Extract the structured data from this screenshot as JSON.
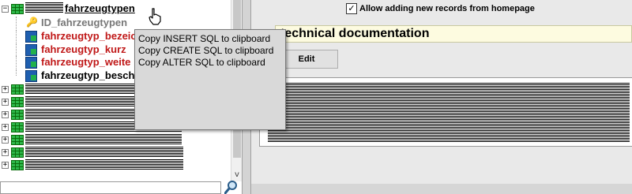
{
  "tree": {
    "top_label": "fahrzeugtypen",
    "fields": [
      {
        "label": "ID_fahrzeugtypen",
        "style": "gray",
        "icon": "key-icon"
      },
      {
        "label": "fahrzeugtyp_bezeichnung",
        "style": "red",
        "icon": "field-icon"
      },
      {
        "label": "fahrzeugtyp_kurz",
        "style": "red",
        "icon": "field-icon"
      },
      {
        "label": "fahrzeugtyp_weite",
        "style": "red",
        "icon": "field-icon"
      },
      {
        "label": "fahrzeugtyp_beschreibung",
        "style": "black",
        "icon": "field-icon"
      }
    ],
    "expander_collapsed": "+",
    "expander_expanded": "−",
    "scroll_down_glyph": "v",
    "search_icon": "magnifier-icon"
  },
  "options": {
    "allow_checked": true,
    "allow_label": "Allow adding new records from homepage",
    "check_glyph": "✓"
  },
  "documentation": {
    "title": "technical documentation",
    "edit_label": "Edit"
  },
  "context_menu": {
    "items": [
      "Copy INSERT SQL to clipboard",
      "Copy CREATE SQL to clipboard",
      "Copy ALTER SQL to clipboard"
    ]
  }
}
